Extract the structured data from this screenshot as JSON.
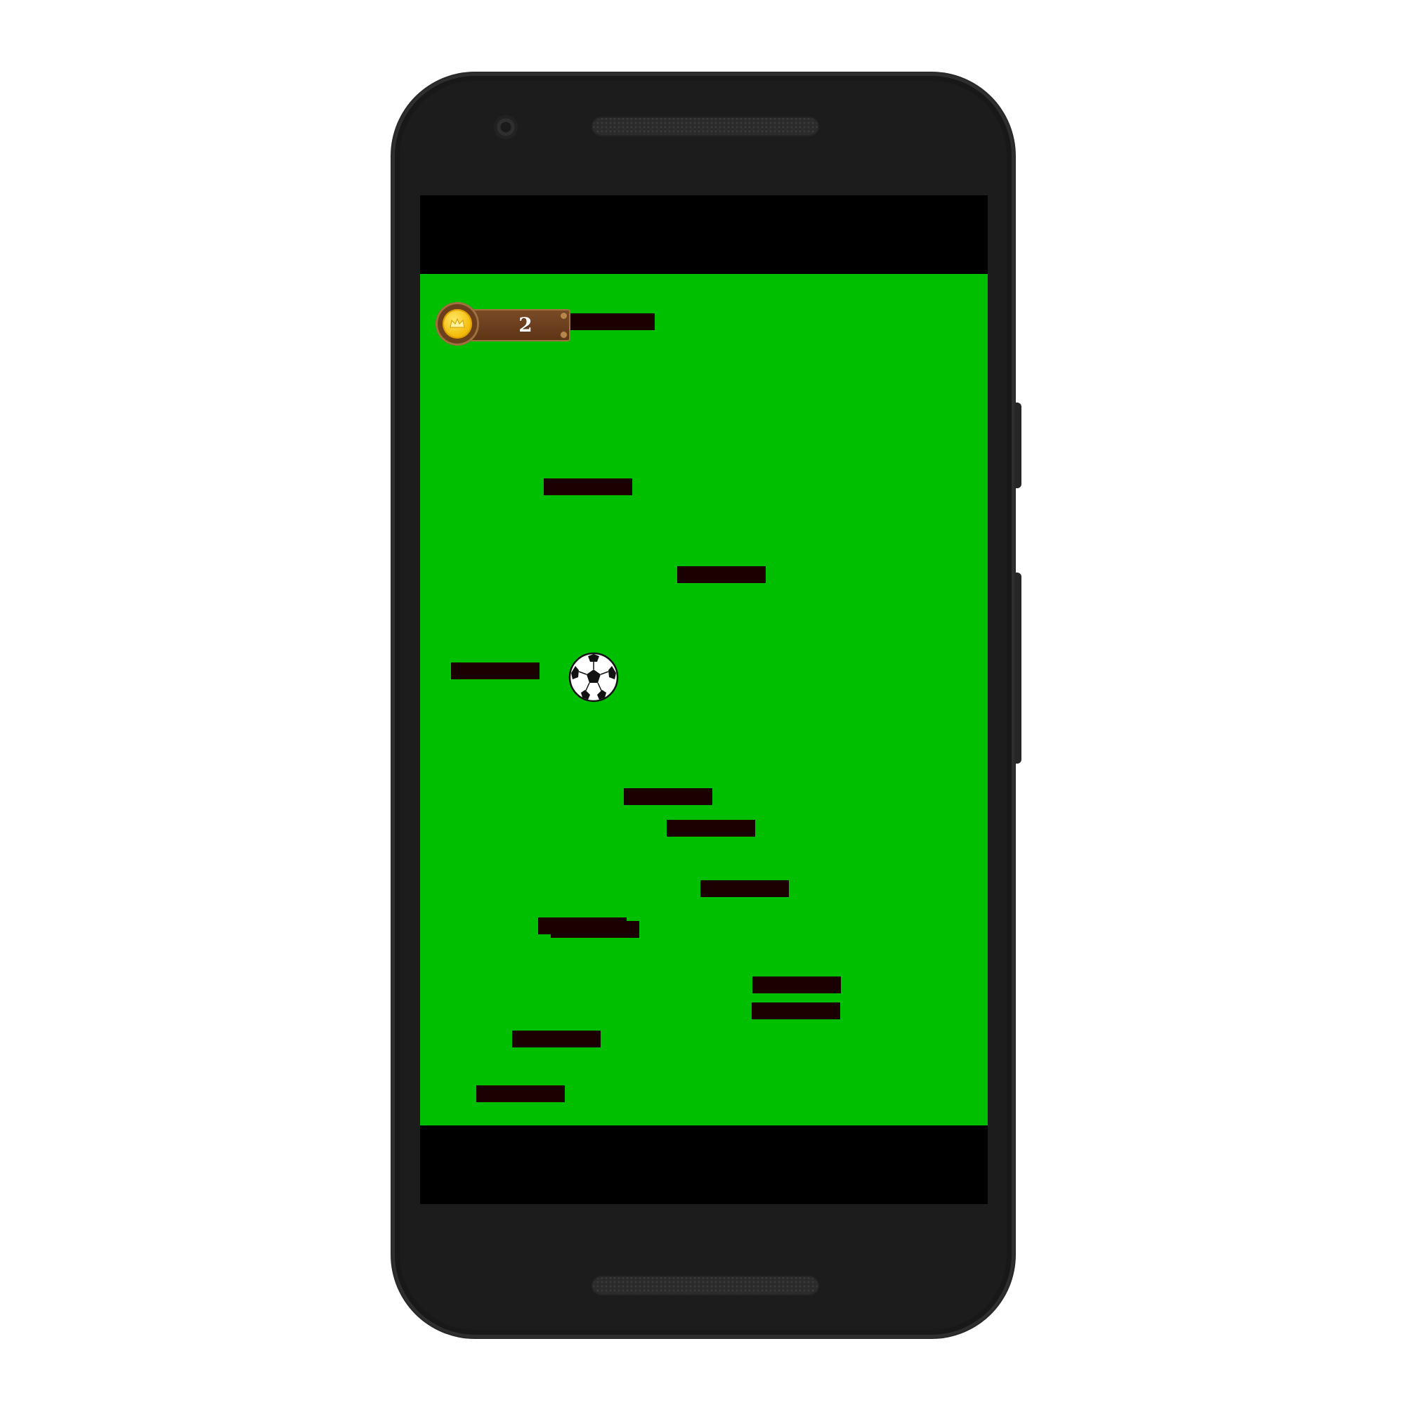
{
  "game": {
    "coins": "2",
    "colors": {
      "field": "#00bf00",
      "platform": "#1a0000",
      "letterbox": "#000000",
      "phone_body": "#1c1c1c"
    },
    "hud": {
      "coin_icon": "coin-icon",
      "panel_style": "wooden-plank"
    },
    "player": {
      "icon": "soccer-ball-icon"
    },
    "platform_count": 14
  }
}
